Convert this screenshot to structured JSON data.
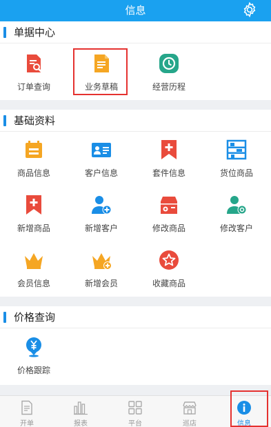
{
  "header": {
    "title": "信息"
  },
  "sections": {
    "orders": {
      "title": "单据中心",
      "items": [
        "订单查询",
        "业务草稿",
        "经营历程"
      ]
    },
    "basics": {
      "title": "基础资料",
      "items": [
        "商品信息",
        "客户信息",
        "套件信息",
        "货位商品",
        "新增商品",
        "新增客户",
        "修改商品",
        "修改客户",
        "会员信息",
        "新增会员",
        "收藏商品"
      ]
    },
    "price": {
      "title": "价格查询",
      "items": [
        "价格跟踪"
      ]
    }
  },
  "tabbar": {
    "items": [
      "开单",
      "报表",
      "平台",
      "巡店",
      "信息"
    ],
    "active": "信息"
  },
  "colors": {
    "header": "#1aa1f0",
    "orange": "#f5a623",
    "red": "#e94b3c",
    "green": "#26a68a",
    "blue": "#1a8ee6",
    "highlight": "#e5312f"
  }
}
